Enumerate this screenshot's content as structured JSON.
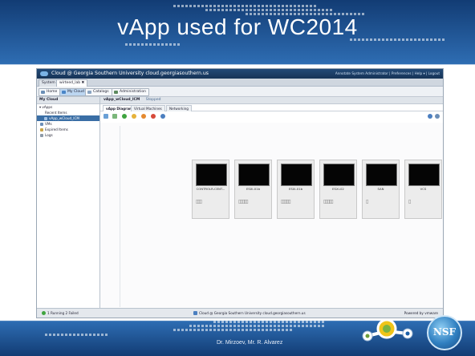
{
  "slide": {
    "title": "vApp used for WC2014",
    "footer": "Dr. Mirzoev, Mr. R. Alvarez",
    "logo_text": "NSF"
  },
  "window": {
    "title": "Cloud @ Georgia Southern University cloud.georgiasouthern.us",
    "right_links": "Annotate   System Administrator  |  Preferences  |  Help  ▾  |  Logout"
  },
  "tabs": [
    {
      "label": "System"
    },
    {
      "label": "wirteed_lab  ✖"
    }
  ],
  "toolbar": {
    "home": "Home",
    "my_cloud": "My Cloud",
    "catalogs": "Catalogs",
    "administration": "Administration"
  },
  "left_panel": {
    "header": "My Cloud",
    "items": [
      {
        "label": "▾ vApps"
      },
      {
        "label": "Recent Items"
      },
      {
        "label": "vApp_wCloud_ICM"
      },
      {
        "label": "VMs"
      },
      {
        "label": "Expired Items"
      },
      {
        "label": "Logs"
      }
    ]
  },
  "right_panel": {
    "header_title": "vApp_wCloud_ICM",
    "header_status": "Stopped",
    "tabs": [
      {
        "label": "vApp Diagram"
      },
      {
        "label": "Virtual Machines"
      },
      {
        "label": "Networking"
      }
    ],
    "vms": [
      {
        "name": "CONTROLR-CENT..."
      },
      {
        "name": "ESXi-01b"
      },
      {
        "name": "ESXi-01b"
      },
      {
        "name": "ESXi-02"
      },
      {
        "name": "SAN"
      },
      {
        "name": "VCS"
      }
    ]
  },
  "statusbar": {
    "left": "1 Running   2 Failed",
    "center": "Cloud @ Georgia Southern University cloud.georgiasouthern.us",
    "right": "Powered by vmware"
  },
  "colors": {
    "slide_blue": "#1f4f8a",
    "title_bar": "#234a77",
    "selection": "#3a6ea5"
  }
}
